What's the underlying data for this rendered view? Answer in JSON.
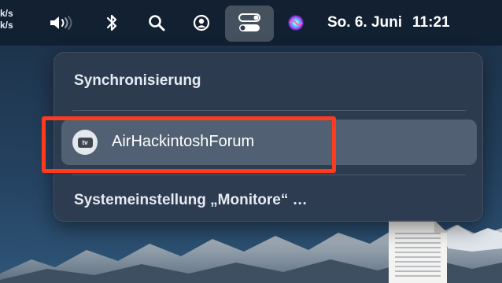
{
  "menubar": {
    "net_speed_up": "k/s",
    "net_speed_down": "k/s",
    "icons": [
      "volume-icon",
      "bluetooth-icon",
      "spotlight-search-icon",
      "user-account-icon",
      "control-center-icon",
      "siri-icon"
    ],
    "date": "So. 6. Juni",
    "time": "11:21"
  },
  "dropdown": {
    "title": "Synchronisierung",
    "device": {
      "name": "AirHackintoshForum",
      "icon_label": "tv"
    },
    "settings_link": "Systemeinstellung „Monitore“ …"
  },
  "colors": {
    "highlight": "#ff3b1f",
    "panel": "#2e3c4f",
    "row_selected": "#5e6b7c"
  }
}
